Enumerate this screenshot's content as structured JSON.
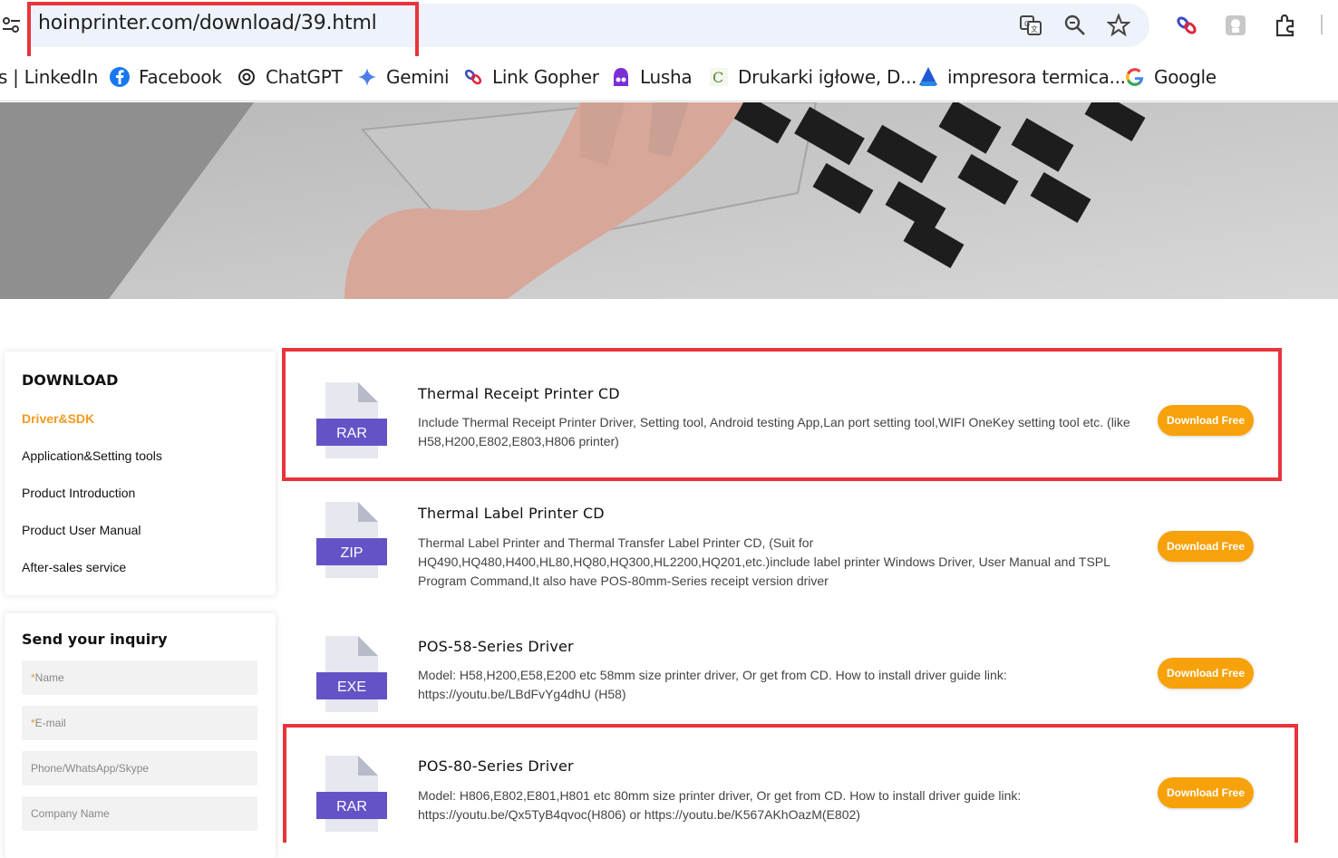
{
  "browser": {
    "url": "hoinprinter.com/download/39.html",
    "bookmarks": [
      {
        "label": "s | LinkedIn",
        "icon": "none"
      },
      {
        "label": "Facebook",
        "icon": "facebook-icon"
      },
      {
        "label": "ChatGPT",
        "icon": "chatgpt-icon"
      },
      {
        "label": "Gemini",
        "icon": "gemini-icon"
      },
      {
        "label": "Link Gopher",
        "icon": "link-gopher-icon"
      },
      {
        "label": "Lusha",
        "icon": "lusha-icon"
      },
      {
        "label": "Drukarki igłowe, D...",
        "icon": "site-favicon-icon"
      },
      {
        "label": "impresora termica...",
        "icon": "site-favicon-icon"
      },
      {
        "label": "Google",
        "icon": "google-icon"
      }
    ]
  },
  "sidebar": {
    "download_title": "DOWNLOAD",
    "items": [
      {
        "label": "Driver&SDK",
        "active": true
      },
      {
        "label": "Application&Setting tools",
        "active": false
      },
      {
        "label": "Product Introduction",
        "active": false
      },
      {
        "label": "Product User Manual",
        "active": false
      },
      {
        "label": "After-sales service",
        "active": false
      }
    ],
    "inquiry": {
      "title": "Send your inquiry",
      "fields": [
        {
          "placeholder": "Name",
          "required": true
        },
        {
          "placeholder": "E-mail",
          "required": true
        },
        {
          "placeholder": "Phone/WhatsApp/Skype",
          "required": false
        },
        {
          "placeholder": "Company Name",
          "required": false
        }
      ]
    }
  },
  "downloads": [
    {
      "file_type": "RAR",
      "title": "Thermal Receipt Printer CD",
      "description": "Include Thermal Receipt Printer Driver, Setting tool, Android testing App,Lan port setting tool,WIFI OneKey setting tool etc. (like H58,H200,E802,E803,H806 printer)",
      "button": "Download Free"
    },
    {
      "file_type": "ZIP",
      "title": "Thermal Label Printer CD",
      "description": "Thermal Label Printer and Thermal Transfer Label Printer CD, (Suit for HQ490,HQ480,H400,HL80,HQ80,HQ300,HL2200,HQ201,etc.)include label printer Windows Driver, User Manual and TSPL Program Command,It also have POS-80mm-Series receipt version driver",
      "button": "Download Free"
    },
    {
      "file_type": "EXE",
      "title": "POS-58-Series Driver",
      "description": "Model: H58,H200,E58,E200 etc 58mm size printer driver, Or get from CD. How to install driver guide link: https://youtu.be/LBdFvYg4dhU (H58)",
      "button": "Download Free"
    },
    {
      "file_type": "RAR",
      "title": "POS-80-Series Driver",
      "description": "Model: H806,E802,E801,H801 etc 80mm size printer driver, Or get from CD. How to install driver guide link: https://youtu.be/Qx5TyB4qvoc(H806) or https://youtu.be/K567AKhOazM(E802)",
      "button": "Download Free"
    }
  ],
  "colors": {
    "accent_orange": "#f7a20b",
    "active_nav": "#f39a1e",
    "file_badge": "#6a5acd",
    "highlight_red": "#e8343c"
  }
}
